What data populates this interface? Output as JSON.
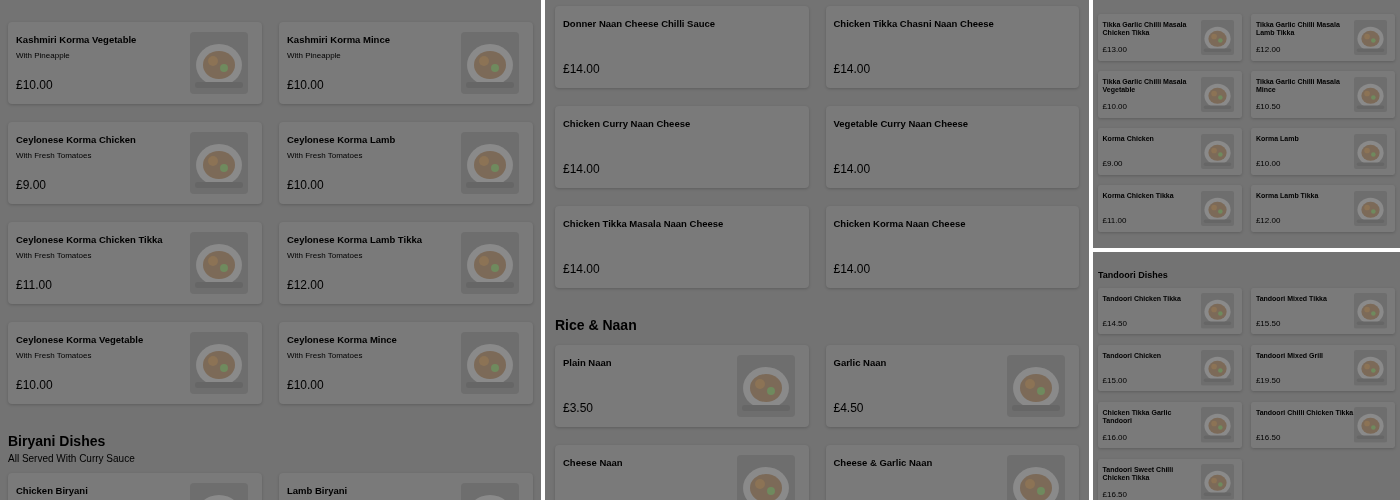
{
  "panels": [
    {
      "sections": [
        {
          "items": [
            {
              "name": "Kashmiri Korma Vegetable",
              "description": "With Pineapple",
              "price": "£10.00",
              "image": true
            },
            {
              "name": "Kashmiri Korma Mince",
              "description": "With Pineapple",
              "price": "£10.00",
              "image": true
            },
            {
              "name": "Ceylonese Korma Chicken",
              "description": "With Fresh Tomatoes",
              "price": "£9.00",
              "image": true
            },
            {
              "name": "Ceylonese Korma Lamb",
              "description": "With Fresh Tomatoes",
              "price": "£10.00",
              "image": true
            },
            {
              "name": "Ceylonese Korma Chicken Tikka",
              "description": "With Fresh Tomatoes",
              "price": "£11.00",
              "image": true
            },
            {
              "name": "Ceylonese Korma Lamb Tikka",
              "description": "With Fresh Tomatoes",
              "price": "£12.00",
              "image": true
            },
            {
              "name": "Ceylonese Korma Vegetable",
              "description": "With Fresh Tomatoes",
              "price": "£10.00",
              "image": true
            },
            {
              "name": "Ceylonese Korma Mince",
              "description": "With Fresh Tomatoes",
              "price": "£10.00",
              "image": true
            }
          ]
        },
        {
          "heading": "Biryani Dishes",
          "subtitle": "All Served With Curry Sauce",
          "items": [
            {
              "name": "Chicken Biryani",
              "image": true
            },
            {
              "name": "Lamb Biryani",
              "image": true
            }
          ]
        }
      ]
    },
    {
      "sections": [
        {
          "items": [
            {
              "name": "Donner Naan Cheese Chilli Sauce",
              "price": "£14.00",
              "image": false
            },
            {
              "name": "Chicken Tikka Chasni Naan Cheese",
              "price": "£14.00",
              "image": false
            },
            {
              "name": "Chicken Curry Naan Cheese",
              "price": "£14.00",
              "image": false
            },
            {
              "name": "Vegetable Curry Naan Cheese",
              "price": "£14.00",
              "image": false
            },
            {
              "name": "Chicken Tikka Masala Naan Cheese",
              "price": "£14.00",
              "image": false
            },
            {
              "name": "Chicken Korma Naan Cheese",
              "price": "£14.00",
              "image": false
            }
          ]
        },
        {
          "heading": "Rice & Naan",
          "items": [
            {
              "name": "Plain Naan",
              "price": "£3.50",
              "image": true
            },
            {
              "name": "Garlic Naan",
              "price": "£4.50",
              "image": true
            },
            {
              "name": "Cheese Naan",
              "image": true
            },
            {
              "name": "Cheese & Garlic Naan",
              "image": true
            }
          ]
        }
      ]
    },
    {
      "sections": [
        {
          "items": [
            {
              "name": "Tikka Garlic Chilli Masala Chicken Tikka",
              "price": "£13.00",
              "image": true
            },
            {
              "name": "Tikka Garlic Chilli Masala Lamb Tikka",
              "price": "£12.00",
              "image": true
            },
            {
              "name": "Tikka Garlic Chilli Masala Vegetable",
              "price": "£10.00",
              "image": true
            },
            {
              "name": "Tikka Garlic Chilli Masala Mince",
              "price": "£10.50",
              "image": true
            },
            {
              "name": "Korma Chicken",
              "price": "£9.00",
              "image": true
            },
            {
              "name": "Korma Lamb",
              "price": "£10.00",
              "image": true
            },
            {
              "name": "Korma Chicken Tikka",
              "price": "£11.00",
              "image": true
            },
            {
              "name": "Korma Lamb Tikka",
              "price": "£12.00",
              "image": true
            }
          ]
        }
      ]
    },
    {
      "sections": [
        {
          "heading": "Tandoori Dishes",
          "items": [
            {
              "name": "Tandoori Chicken Tikka",
              "price": "£14.50",
              "image": true
            },
            {
              "name": "Tandoori Mixed Tikka",
              "price": "£15.50",
              "image": true
            },
            {
              "name": "Tandoori Chicken",
              "price": "£15.00",
              "image": true
            },
            {
              "name": "Tandoori Mixed Grill",
              "price": "£19.50",
              "image": true
            },
            {
              "name": "Chicken Tikka Garlic Tandoori",
              "price": "£16.00",
              "image": true
            },
            {
              "name": "Tandoori Chilli Chicken Tikka",
              "price": "£16.50",
              "image": true
            },
            {
              "name": "Tandoori Sweet Chilli Chicken Tikka",
              "price": "£16.50",
              "image": true
            }
          ]
        }
      ]
    }
  ]
}
